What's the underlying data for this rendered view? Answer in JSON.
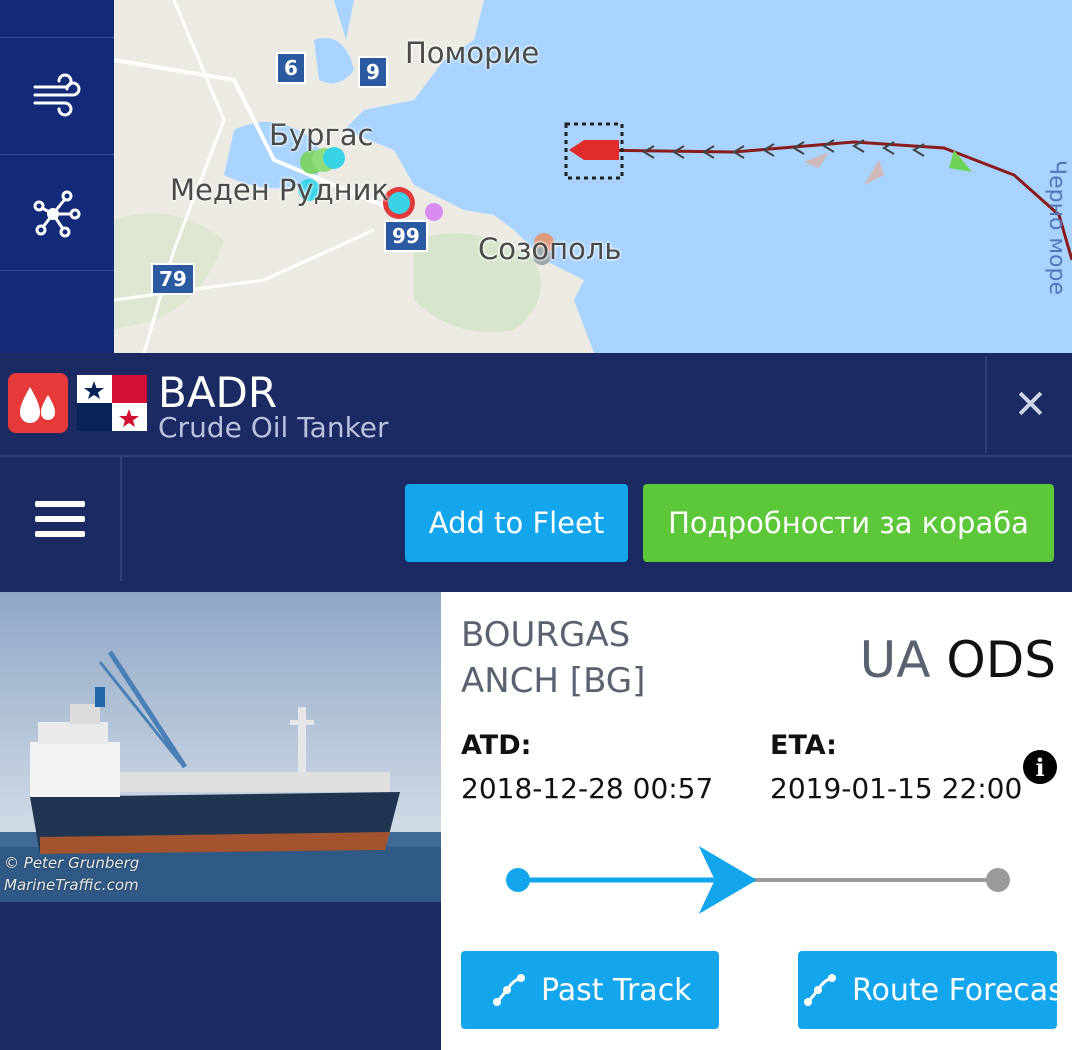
{
  "map": {
    "labels": {
      "pomorie": "Поморие",
      "burgas": "Бургас",
      "meden_rudnik": "Меден Рудник",
      "sozopol": "Созополь",
      "black_sea": "Черно море"
    },
    "route_badges": {
      "r6": "6",
      "r9": "9",
      "r99": "99",
      "r79": "79"
    }
  },
  "vessel": {
    "name": "BADR",
    "type": "Crude Oil Tanker",
    "flag": "Panama"
  },
  "toolbar": {
    "add_to_fleet": "Add to Fleet",
    "vessel_details": "Подробности за кораба"
  },
  "photo": {
    "credit_line1": "© Peter Grunberg",
    "credit_line2": "MarineTraffic.com"
  },
  "voyage": {
    "origin": "BOURGAS ANCH [BG]",
    "dest_country": "UA",
    "dest_port": "ODS",
    "atd_label": "ATD:",
    "atd_value": "2018-12-28 00:57",
    "eta_label": "ETA:",
    "eta_value": "2019-01-15 22:00",
    "progress_fraction": 0.46
  },
  "actions": {
    "past_track": "Past Track",
    "route_forecast": "Route Forecast"
  },
  "colors": {
    "navy": "#1b2a62",
    "rail": "#122a77",
    "blue_button": "#13a6ec",
    "green_button": "#5cc738",
    "sea": "#a8d4ff",
    "land": "#eceae2"
  }
}
